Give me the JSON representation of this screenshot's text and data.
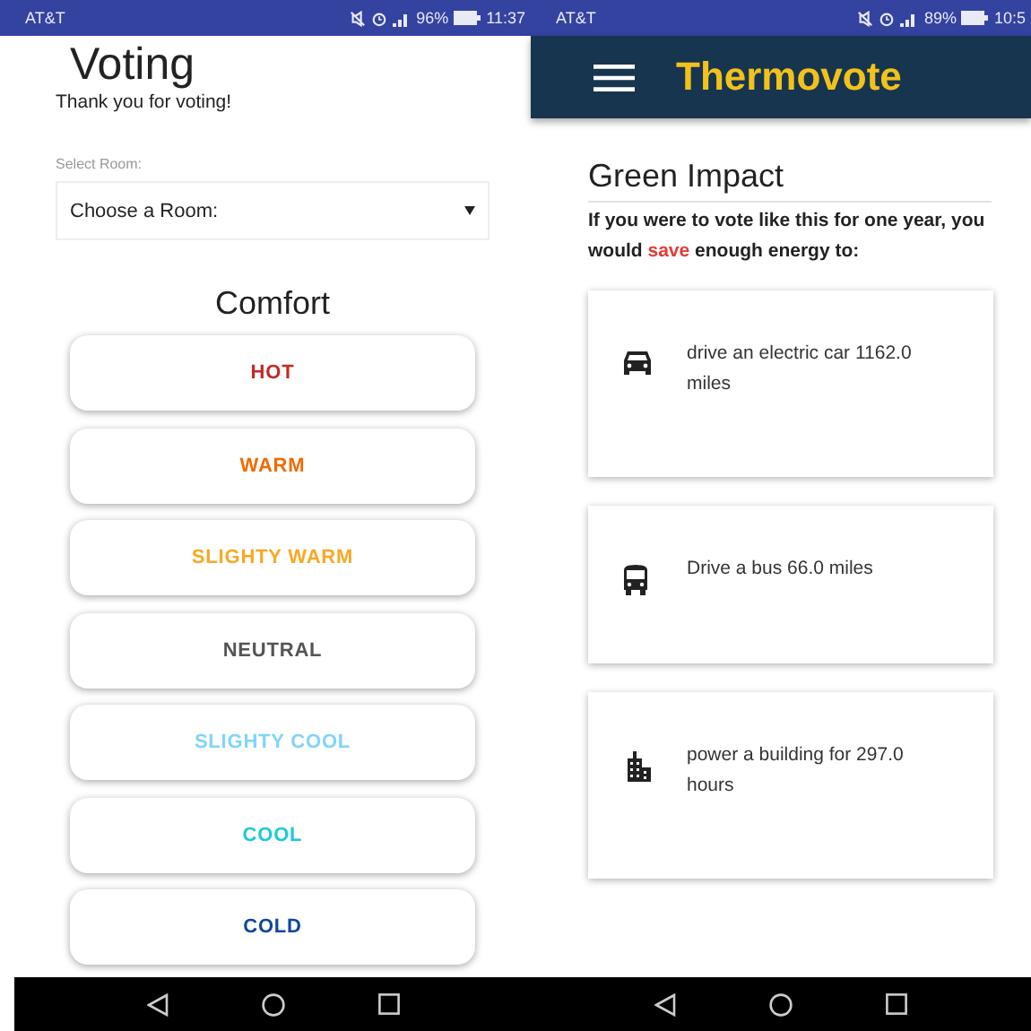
{
  "voting_screen": {
    "status_bar": {
      "carrier": "AT&T",
      "battery": "96%",
      "time": "11:37"
    },
    "title": "Voting",
    "message": "Thank you for voting!",
    "room_select": {
      "label": "Select Room:",
      "value": "Choose a Room:"
    },
    "section_title": "Comfort",
    "options": [
      {
        "label": "HOT",
        "color": "#c62828"
      },
      {
        "label": "WARM",
        "color": "#ef6c00"
      },
      {
        "label": "SLIGHTY WARM",
        "color": "#f9a825"
      },
      {
        "label": "NEUTRAL",
        "color": "#555555"
      },
      {
        "label": "SLIGHTY COOL",
        "color": "#81d4fa"
      },
      {
        "label": "COOL",
        "color": "#1ec8dc"
      },
      {
        "label": "COLD",
        "color": "#0d47a1"
      }
    ]
  },
  "impact_screen": {
    "status_bar": {
      "carrier": "AT&T",
      "battery": "89%",
      "time": "10:5"
    },
    "app_title": "Thermovote",
    "heading": "Green Impact",
    "intro": [
      {
        "text": "If you were to vote like this for one year, you would ",
        "highlight": false
      },
      {
        "text": "save",
        "highlight": true
      },
      {
        "text": " enough energy to:",
        "highlight": false
      }
    ],
    "cards": [
      {
        "kind": "car",
        "text": "drive an electric car 1162.0 miles"
      },
      {
        "kind": "bus",
        "text": "Drive a bus 66.0 miles"
      },
      {
        "kind": "building",
        "text": "power a building for 297.0 hours"
      }
    ]
  }
}
